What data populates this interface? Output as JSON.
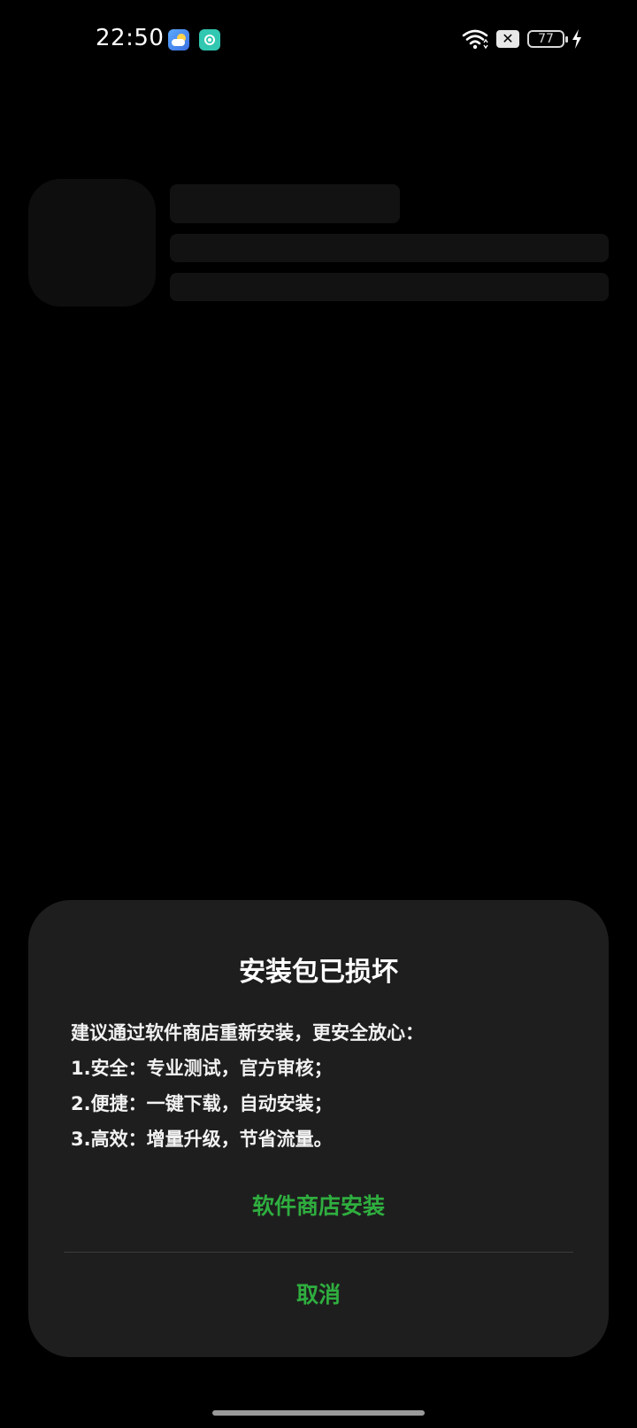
{
  "status_bar": {
    "time": "22:50",
    "battery_level": "77",
    "icons": [
      "weather-app-icon",
      "message-app-icon",
      "wifi-icon",
      "no-sim-icon",
      "battery-icon",
      "charging-icon"
    ]
  },
  "dialog": {
    "title": "安装包已损坏",
    "message_lines": [
      "建议通过软件商店重新安装，更安全放心：",
      "1.安全：专业测试，官方审核；",
      "2.便捷：一键下载，自动安装；",
      "3.高效：增量升级，节省流量。"
    ],
    "primary_action": "软件商店安装",
    "cancel_action": "取消"
  },
  "colors": {
    "background": "#000000",
    "dialog_background": "#1e1e1e",
    "accent": "#2fae3f",
    "skeleton": "#121212"
  }
}
